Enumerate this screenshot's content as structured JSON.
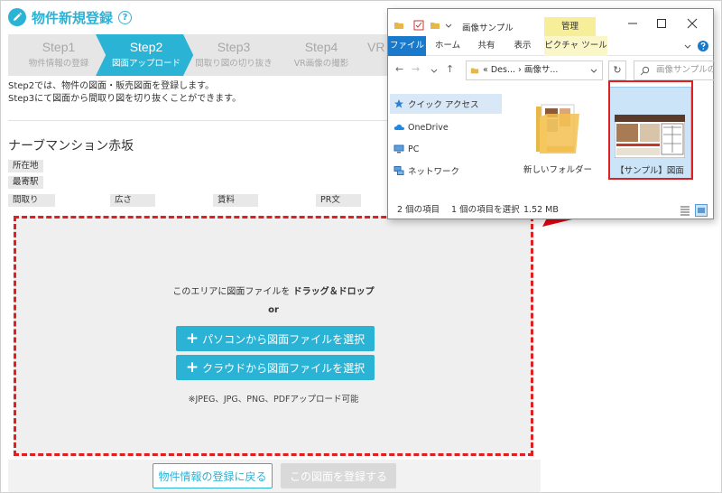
{
  "header": {
    "title": "物件新規登録",
    "help": "?"
  },
  "steps": [
    {
      "name": "Step1",
      "sub": "物件情報の登録"
    },
    {
      "name": "Step2",
      "sub": "図面アップロード"
    },
    {
      "name": "Step3",
      "sub": "間取り図の切り抜き"
    },
    {
      "name": "Step4",
      "sub": "VR画像の撮影"
    },
    {
      "name": "VR",
      "sub": ""
    }
  ],
  "description": {
    "line1": "Step2では、物件の図面・販売図面を登録します。",
    "line2": "Step3にて図面から間取り図を切り抜くことができます。"
  },
  "property": {
    "name": "ナーブマンション赤坂",
    "address_label": "所在地",
    "station_label": "最寄駅",
    "columns": [
      "間取り",
      "広さ",
      "賃料",
      "PR文"
    ]
  },
  "dropzone": {
    "instruction_prefix": "このエリアに図面ファイルを",
    "instruction_bold": "ドラッグ＆ドロップ",
    "or": "or",
    "pc_button": "パソコンから図面ファイルを選択",
    "cloud_button": "クラウドから図面ファイルを選択",
    "plus": "+",
    "note": "※JPEG、JPG、PNG、PDFアップロード可能"
  },
  "bottom": {
    "back_label": "物件情報の登録に戻る",
    "register_label": "この図面を登録する"
  },
  "explorer": {
    "title": "画像サンプル",
    "manage": "管理",
    "tabs": [
      "ファイル",
      "ホーム",
      "共有",
      "表示",
      "ピクチャ ツール"
    ],
    "address": "«  Des...  ›  画像サ...",
    "search_placeholder": "画像サンプルの検索",
    "nav": [
      "クイック アクセス",
      "OneDrive",
      "PC",
      "ネットワーク"
    ],
    "files": [
      {
        "name": "新しいフォルダー"
      },
      {
        "name": "【サンプル】図面"
      }
    ],
    "status": {
      "count": "2 個の項目",
      "selected": "1 個の項目を選択",
      "size": "1.52 MB"
    }
  },
  "colors": {
    "accent": "#2bb3d6",
    "dashed_border": "#e02020",
    "ribbon_file": "#1979ca",
    "manage_bg": "#f7ee9a"
  }
}
